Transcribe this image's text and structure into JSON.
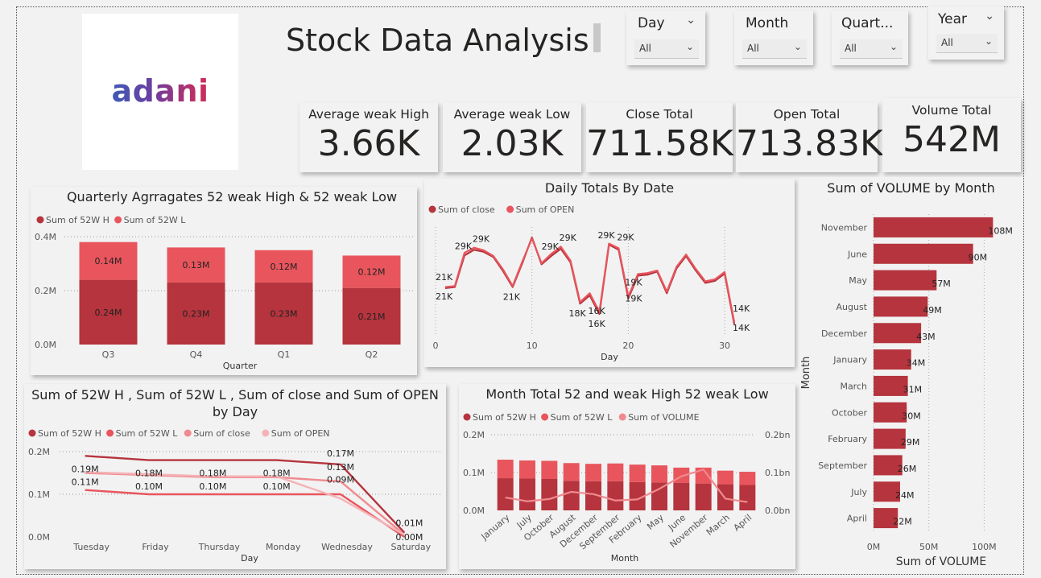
{
  "header": {
    "title": "Stock Data Analysis",
    "logo_text": "adani"
  },
  "slicers": [
    {
      "title": "Day",
      "value": "All"
    },
    {
      "title": "Month",
      "value": "All"
    },
    {
      "title": "Quart...",
      "value": "All"
    },
    {
      "title": "Year",
      "value": "All"
    }
  ],
  "kpis": [
    {
      "label": "Average weak High",
      "value": "3.66K"
    },
    {
      "label": "Average weak Low",
      "value": "2.03K"
    },
    {
      "label": "Close Total",
      "value": "711.58K"
    },
    {
      "label": "Open Total",
      "value": "713.83K"
    },
    {
      "label": "Volume Total",
      "value": "542M"
    }
  ],
  "colors": {
    "dark_red": "#b5343d",
    "light_red": "#e8555d",
    "pink": "#f08a8f",
    "light_pink": "#f5b3b6",
    "background": "#f2f2f2"
  },
  "chart_data": [
    {
      "id": "quarterly",
      "type": "bar",
      "stacked": true,
      "title": "Quarterly Agrragates 52 weak High & 52 weak Low",
      "xlabel": "Quarter",
      "ylabel": "",
      "categories": [
        "Q3",
        "Q4",
        "Q1",
        "Q2"
      ],
      "series": [
        {
          "name": "Sum of 52W H",
          "values": [
            0.24,
            0.23,
            0.23,
            0.21
          ],
          "labels": [
            "0.24M",
            "0.23M",
            "0.23M",
            "0.21M"
          ]
        },
        {
          "name": "Sum of 52W L",
          "values": [
            0.14,
            0.13,
            0.12,
            0.12
          ],
          "labels": [
            "0.14M",
            "0.13M",
            "0.12M",
            "0.12M"
          ]
        }
      ],
      "ylim": [
        0,
        0.4
      ],
      "yticks": [
        {
          "v": 0,
          "label": "0.0M"
        },
        {
          "v": 0.2,
          "label": "0.2M"
        },
        {
          "v": 0.4,
          "label": "0.4M"
        }
      ],
      "grid": true,
      "legend": "top-left"
    },
    {
      "id": "daily",
      "type": "line",
      "title": "Daily Totals By Date",
      "xlabel": "Day",
      "ylabel": "",
      "x": [
        1,
        2,
        3,
        4,
        5,
        6,
        7,
        8,
        9,
        10,
        11,
        12,
        13,
        14,
        15,
        16,
        17,
        18,
        19,
        20,
        21,
        22,
        23,
        24,
        25,
        26,
        27,
        28,
        29,
        30,
        31
      ],
      "series": [
        {
          "name": "Sum of close",
          "values": [
            21.2,
            21.4,
            27.5,
            28.6,
            28.2,
            27.2,
            24.5,
            21.4,
            26.0,
            31.0,
            25.8,
            27.4,
            28.8,
            26.2,
            18.2,
            19.8,
            16.2,
            29.6,
            28.6,
            19.2,
            23.6,
            23.8,
            24.4,
            20.2,
            25.0,
            27.4,
            24.6,
            22.2,
            22.6,
            24.0,
            14.2
          ]
        },
        {
          "name": "Sum of OPEN",
          "values": [
            21.4,
            21.6,
            28.0,
            29.0,
            28.5,
            27.4,
            24.8,
            21.6,
            26.3,
            30.8,
            26.0,
            27.8,
            29.2,
            26.5,
            18.5,
            20.2,
            16.6,
            29.8,
            28.9,
            19.6,
            23.9,
            24.1,
            24.6,
            20.5,
            25.3,
            27.7,
            24.9,
            22.5,
            22.9,
            24.3,
            14.6
          ]
        }
      ],
      "data_labels": [
        {
          "x": 1,
          "label": "21K"
        },
        {
          "x": 1,
          "label": "21K"
        },
        {
          "x": 3,
          "label": "29K"
        },
        {
          "x": 4,
          "label": "29K"
        },
        {
          "x": 8,
          "label": "21K"
        },
        {
          "x": 12,
          "label": "29K"
        },
        {
          "x": 13,
          "label": "29K"
        },
        {
          "x": 15,
          "label": "18K"
        },
        {
          "x": 17,
          "label": "16K"
        },
        {
          "x": 17,
          "label": "16K"
        },
        {
          "x": 18,
          "label": "29K"
        },
        {
          "x": 19,
          "label": "29K"
        },
        {
          "x": 20,
          "label": "19K"
        },
        {
          "x": 20,
          "label": "19K"
        },
        {
          "x": 31,
          "label": "14K"
        },
        {
          "x": 31,
          "label": "14K"
        }
      ],
      "xticks": [
        0,
        10,
        20,
        30
      ],
      "xlim": [
        0,
        32
      ],
      "ylim": [
        12,
        33
      ],
      "grid": true,
      "legend": "top-left"
    },
    {
      "id": "volume_month",
      "type": "bar",
      "orientation": "horizontal",
      "title": "Sum of VOLUME by Month",
      "xlabel": "Sum of VOLUME",
      "ylabel": "Month",
      "categories": [
        "November",
        "June",
        "May",
        "August",
        "December",
        "January",
        "March",
        "October",
        "February",
        "September",
        "July",
        "April"
      ],
      "values": [
        108,
        90,
        57,
        49,
        43,
        34,
        31,
        30,
        29,
        26,
        24,
        22
      ],
      "value_labels": [
        "108M",
        "90M",
        "57M",
        "49M",
        "43M",
        "34M",
        "31M",
        "30M",
        "29M",
        "26M",
        "24M",
        "22M"
      ],
      "xlim": [
        0,
        115
      ],
      "xticks": [
        {
          "v": 0,
          "label": "0M"
        },
        {
          "v": 50,
          "label": "50M"
        },
        {
          "v": 100,
          "label": "100M"
        }
      ],
      "grid": true
    },
    {
      "id": "by_day",
      "type": "line",
      "title": "Sum of 52W H , Sum of 52W L , Sum of close and Sum of OPEN by Day",
      "xlabel": "Day",
      "ylabel": "",
      "categories": [
        "Tuesday",
        "Friday",
        "Thursday",
        "Monday",
        "Wednesday",
        "Saturday"
      ],
      "series": [
        {
          "name": "Sum of 52W H",
          "values": [
            0.19,
            0.18,
            0.18,
            0.18,
            0.17,
            0.01
          ],
          "labels": [
            "0.19M",
            "0.18M",
            "0.18M",
            "0.18M",
            "0.17M",
            "0.01M"
          ]
        },
        {
          "name": "Sum of 52W L",
          "values": [
            0.11,
            0.1,
            0.1,
            0.1,
            0.1,
            0.0
          ],
          "labels": [
            "0.11M",
            "0.10M",
            "0.10M",
            "0.10M",
            "",
            "0.00M"
          ]
        },
        {
          "name": "Sum of close",
          "values": [
            0.15,
            0.145,
            0.14,
            0.14,
            0.13,
            0.005
          ],
          "labels": [
            "",
            "",
            "",
            "",
            "0.13M",
            ""
          ]
        },
        {
          "name": "Sum of OPEN",
          "values": [
            0.152,
            0.147,
            0.142,
            0.142,
            0.09,
            0.005
          ],
          "labels": [
            "",
            "",
            "",
            "",
            "0.09M",
            ""
          ]
        }
      ],
      "ylim": [
        0,
        0.2
      ],
      "yticks": [
        {
          "v": 0,
          "label": "0.0M"
        },
        {
          "v": 0.1,
          "label": "0.1M"
        },
        {
          "v": 0.2,
          "label": "0.2M"
        }
      ],
      "grid": true,
      "legend": "top-left"
    },
    {
      "id": "month_total",
      "type": "bar",
      "stacked": true,
      "title": "Month Total 52 and weak High 52 weak Low",
      "xlabel": "Month",
      "ylabel": "",
      "categories": [
        "January",
        "July",
        "October",
        "August",
        "December",
        "September",
        "February",
        "May",
        "June",
        "November",
        "March",
        "April"
      ],
      "series": [
        {
          "name": "Sum of 52W H",
          "values": [
            0.085,
            0.084,
            0.083,
            0.078,
            0.077,
            0.077,
            0.075,
            0.074,
            0.073,
            0.071,
            0.069,
            0.067
          ]
        },
        {
          "name": "Sum of 52W L",
          "values": [
            0.049,
            0.048,
            0.048,
            0.047,
            0.046,
            0.047,
            0.046,
            0.045,
            0.04,
            0.042,
            0.036,
            0.035
          ]
        },
        {
          "name": "Sum of VOLUME",
          "axis": "secondary",
          "values": [
            0.034,
            0.024,
            0.03,
            0.049,
            0.043,
            0.026,
            0.029,
            0.057,
            0.09,
            0.108,
            0.031,
            0.022
          ]
        }
      ],
      "ylim": [
        0,
        0.2
      ],
      "yticks": [
        {
          "v": 0,
          "label": "0.0M"
        },
        {
          "v": 0.1,
          "label": "0.1M"
        },
        {
          "v": 0.2,
          "label": "0.2M"
        }
      ],
      "y2lim": [
        0,
        0.2
      ],
      "y2ticks": [
        {
          "v": 0,
          "label": "0.0bn"
        },
        {
          "v": 0.1,
          "label": "0.1bn"
        },
        {
          "v": 0.2,
          "label": "0.2bn"
        }
      ],
      "grid": true,
      "legend": "top-left"
    }
  ]
}
